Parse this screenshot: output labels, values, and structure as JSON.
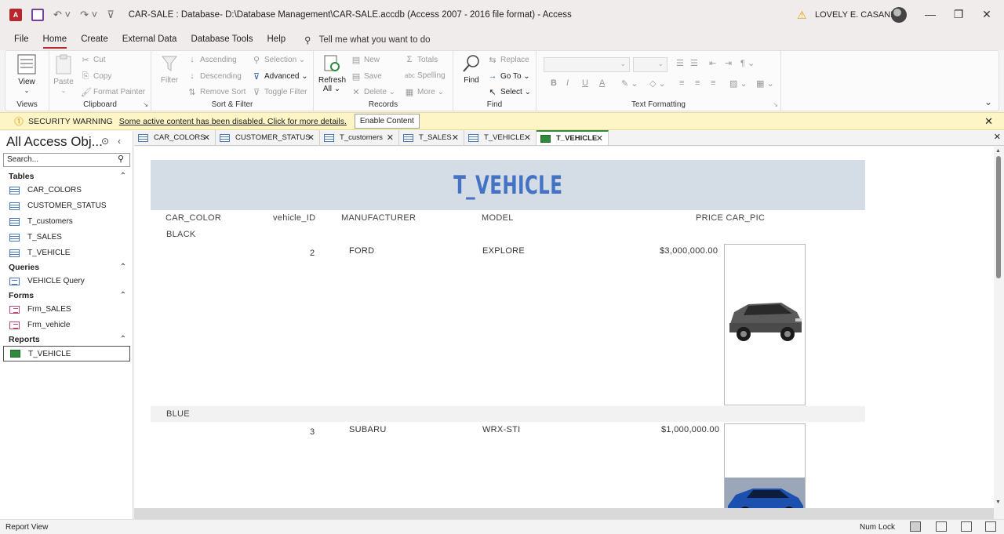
{
  "titlebar": {
    "app_icon": "access-app-icon",
    "title": "CAR-SALE : Database- D:\\Database Management\\CAR-SALE.accdb (Access 2007 - 2016 file format)  -  Access",
    "user": "LOVELY E. CASANDIG"
  },
  "menu": {
    "tabs": [
      "File",
      "Home",
      "Create",
      "External Data",
      "Database Tools",
      "Help"
    ],
    "active": "Home",
    "tell_me": "Tell me what you want to do"
  },
  "ribbon": {
    "views": {
      "view": "View",
      "label": "Views"
    },
    "clipboard": {
      "paste": "Paste",
      "cut": "Cut",
      "copy": "Copy",
      "format_painter": "Format Painter",
      "label": "Clipboard"
    },
    "sort_filter": {
      "filter": "Filter",
      "ascending": "Ascending",
      "descending": "Descending",
      "remove_sort": "Remove Sort",
      "selection": "Selection",
      "advanced": "Advanced",
      "toggle_filter": "Toggle Filter",
      "label": "Sort & Filter"
    },
    "records": {
      "refresh": "Refresh",
      "refresh_all": "All",
      "new": "New",
      "save": "Save",
      "delete": "Delete",
      "totals": "Totals",
      "spelling": "Spelling",
      "more": "More",
      "label": "Records"
    },
    "find": {
      "find": "Find",
      "replace": "Replace",
      "goto": "Go To",
      "select": "Select",
      "label": "Find"
    },
    "text_formatting": {
      "bold": "B",
      "italic": "I",
      "underline": "U",
      "font_color": "A",
      "label": "Text Formatting"
    }
  },
  "security": {
    "title": "SECURITY WARNING",
    "message": "Some active content has been disabled. Click for more details.",
    "button": "Enable Content"
  },
  "nav": {
    "title": "All Access Obj...",
    "search_placeholder": "Search...",
    "categories": {
      "tables": "Tables",
      "queries": "Queries",
      "forms": "Forms",
      "reports": "Reports"
    },
    "tables": [
      "CAR_COLORS",
      "CUSTOMER_STATUS",
      "T_customers",
      "T_SALES",
      "T_VEHICLE"
    ],
    "queries": [
      "VEHICLE Query"
    ],
    "forms": [
      "Frm_SALES",
      "Frm_vehicle"
    ],
    "reports": [
      "T_VEHICLE"
    ]
  },
  "doc_tabs": [
    "CAR_COLORS",
    "CUSTOMER_STATUS",
    "T_customers",
    "T_SALES",
    "T_VEHICLE",
    "T_VEHICLE"
  ],
  "report": {
    "title": "T_VEHICLE",
    "columns": {
      "car_color": "CAR_COLOR",
      "vehicle_id": "vehicle_ID",
      "manufacturer": "MANUFACTURER",
      "model": "MODEL",
      "price_pic": "PRICE CAR_PIC"
    },
    "groups": [
      {
        "color": "BLACK",
        "vehicle_id": "2",
        "manufacturer": "FORD",
        "model": "EXPLORE",
        "price": "$3,000,000.00",
        "car_pic": "gray-suv-photo"
      },
      {
        "color": "BLUE",
        "vehicle_id": "3",
        "manufacturer": "SUBARU",
        "model": "WRX-STI",
        "price": "$1,000,000.00",
        "car_pic": "blue-sedan-photo"
      }
    ]
  },
  "status": {
    "view": "Report View",
    "num_lock": "Num Lock"
  },
  "colors": {
    "accent": "#b7282e",
    "report_title": "#4472c4",
    "report_header_bg": "#d4dce6",
    "security_bg": "#fdf5c6"
  }
}
